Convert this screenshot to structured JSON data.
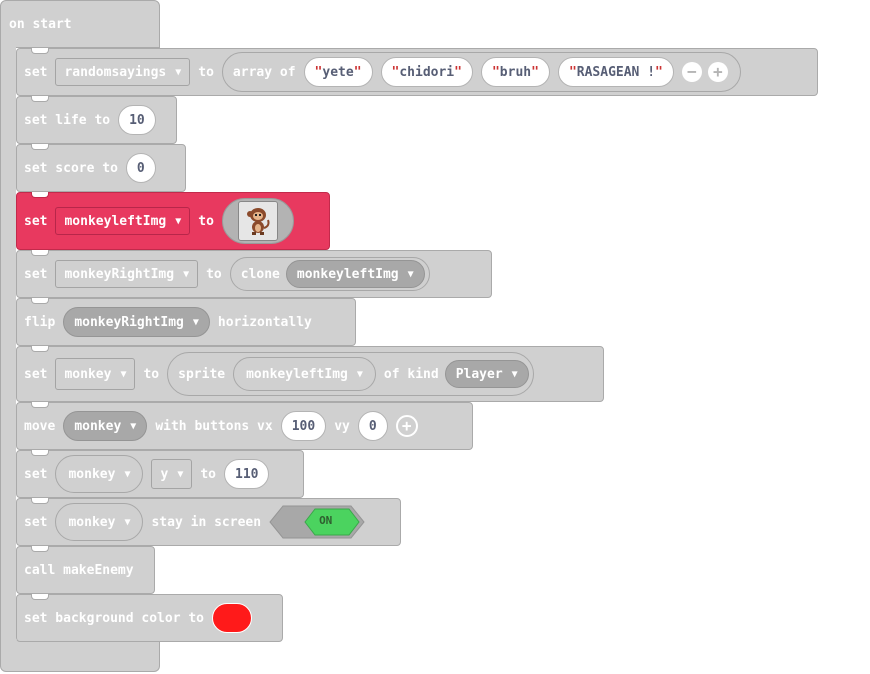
{
  "event": {
    "label": "on start"
  },
  "blocks": {
    "b1": {
      "set": "set",
      "var": "randomsayings",
      "to": "to",
      "array_of": "array of",
      "items": [
        "yete",
        "chidori",
        "bruh",
        "RASAGEAN !"
      ]
    },
    "b2": {
      "text": "set life to",
      "value": "10"
    },
    "b3": {
      "text": "set score to",
      "value": "0"
    },
    "b4": {
      "set": "set",
      "var": "monkeyleftImg",
      "to": "to"
    },
    "b5": {
      "set": "set",
      "var": "monkeyRightImg",
      "to": "to",
      "clone": "clone",
      "clone_var": "monkeyleftImg"
    },
    "b6": {
      "flip": "flip",
      "var": "monkeyRightImg",
      "horizontally": "horizontally"
    },
    "b7": {
      "set": "set",
      "var": "monkey",
      "to": "to",
      "sprite": "sprite",
      "sprite_img": "monkeyleftImg",
      "of_kind": "of kind",
      "kind": "Player"
    },
    "b8": {
      "move": "move",
      "var": "monkey",
      "with_buttons": "with buttons vx",
      "vx": "100",
      "vy_label": "vy",
      "vy": "0"
    },
    "b9": {
      "set": "set",
      "var": "monkey",
      "prop": "y",
      "to": "to",
      "value": "110"
    },
    "b10": {
      "set": "set",
      "var": "monkey",
      "stay": "stay in screen",
      "toggle": "ON"
    },
    "b11": {
      "text": "call makeEnemy"
    },
    "b12": {
      "text": "set background color to",
      "color": "#ff1a1a"
    }
  },
  "colors": {
    "block_gray": "#d0d0d0",
    "block_red": "#e8395f",
    "toggle_on": "#4bd35f"
  },
  "icons": [
    "dropdown-caret-icon",
    "minus-icon",
    "plus-icon",
    "monkey-sprite-image"
  ]
}
